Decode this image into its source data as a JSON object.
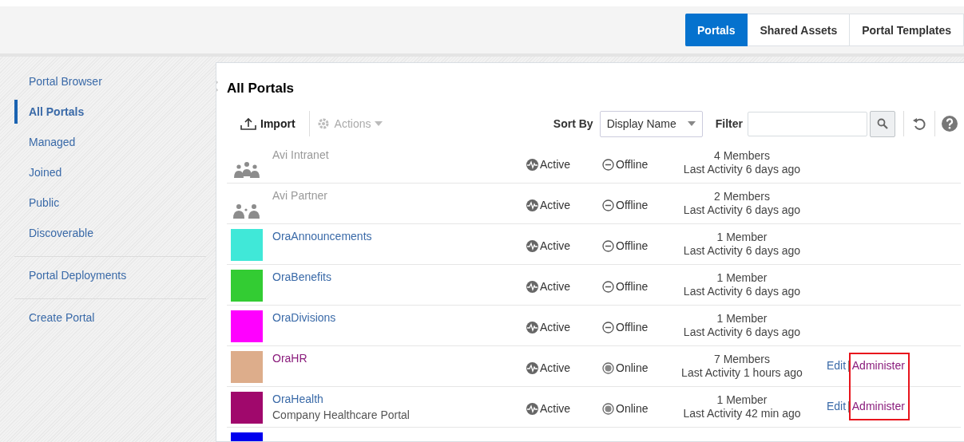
{
  "header_tabs": [
    {
      "label": "Portals",
      "selected": true
    },
    {
      "label": "Shared Assets",
      "selected": false
    },
    {
      "label": "Portal Templates",
      "selected": false
    }
  ],
  "sidebar": {
    "groups": [
      {
        "items": [
          {
            "label": "Portal Browser",
            "selected": false
          },
          {
            "label": "All Portals",
            "selected": true
          },
          {
            "label": "Managed",
            "selected": false
          },
          {
            "label": "Joined",
            "selected": false
          },
          {
            "label": "Public",
            "selected": false
          },
          {
            "label": "Discoverable",
            "selected": false
          }
        ]
      },
      {
        "items": [
          {
            "label": "Portal Deployments",
            "selected": false
          }
        ]
      },
      {
        "items": [
          {
            "label": "Create Portal",
            "selected": false
          }
        ]
      }
    ]
  },
  "panel": {
    "title": "All Portals",
    "toolbar": {
      "import": "Import",
      "actions": {
        "label": "Actions",
        "disabled": true
      },
      "sort_label": "Sort By",
      "sort_value": "Display Name",
      "filter_label": "Filter"
    },
    "portals": [
      {
        "kind": "group",
        "name": "Avi Intranet",
        "disabled": true,
        "status": "Active",
        "availability": "Offline",
        "online": false,
        "members": "4 Members",
        "activity": "Last Activity 6 days ago"
      },
      {
        "kind": "partner",
        "name": "Avi Partner",
        "disabled": true,
        "status": "Active",
        "availability": "Offline",
        "online": false,
        "members": "2 Members",
        "activity": "Last Activity 6 days ago"
      },
      {
        "kind": "color",
        "color": "#40e8d8",
        "name": "OraAnnouncements",
        "disabled": false,
        "visited": false,
        "status": "Active",
        "availability": "Offline",
        "online": false,
        "members": "1 Member",
        "activity": "Last Activity 6 days ago"
      },
      {
        "kind": "color",
        "color": "#33cc33",
        "name": "OraBenefits",
        "disabled": false,
        "visited": false,
        "status": "Active",
        "availability": "Offline",
        "online": false,
        "members": "1 Member",
        "activity": "Last Activity 6 days ago"
      },
      {
        "kind": "color",
        "color": "#ff00ff",
        "name": "OraDivisions",
        "disabled": false,
        "visited": false,
        "status": "Active",
        "availability": "Offline",
        "online": false,
        "members": "1 Member",
        "activity": "Last Activity 6 days ago"
      },
      {
        "kind": "color",
        "color": "#ddad8b",
        "name": "OraHR",
        "disabled": false,
        "visited": true,
        "status": "Active",
        "availability": "Online",
        "online": true,
        "members": "7 Members",
        "activity": "Last Activity 1 hours ago",
        "edit": "Edit",
        "separator": "|",
        "administer": "Administer",
        "highlighted": true
      },
      {
        "kind": "color",
        "color": "#a0086c",
        "name": "OraHealth",
        "description": "Company Healthcare Portal",
        "disabled": false,
        "visited": false,
        "status": "Active",
        "availability": "Online",
        "online": true,
        "members": "1 Member",
        "activity": "Last Activity 42 min ago",
        "edit": "Edit",
        "separator": "|",
        "administer": "Administer",
        "highlighted": true
      },
      {
        "kind": "color",
        "color": "#0000ee"
      }
    ]
  }
}
